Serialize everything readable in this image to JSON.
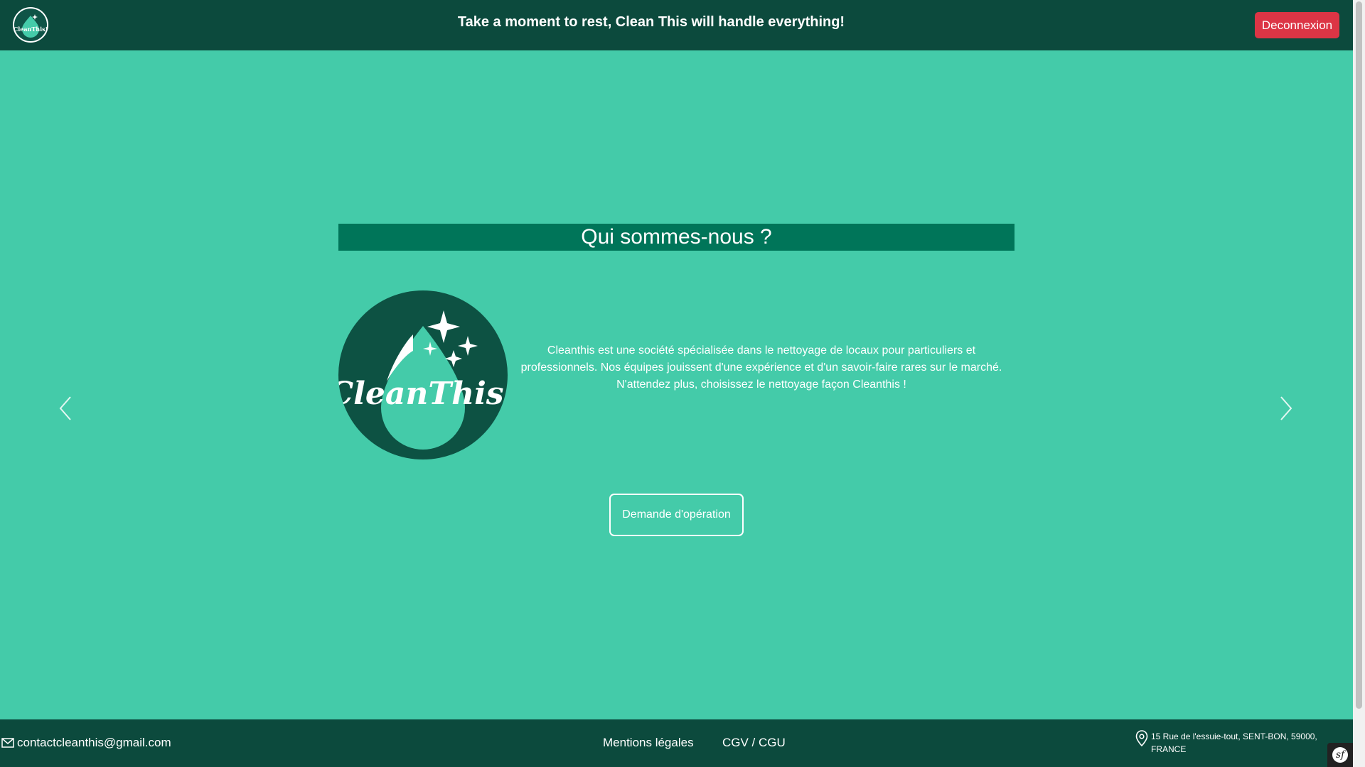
{
  "header": {
    "tagline": "Take a moment to rest, Clean This will handle everything!",
    "logout_label": "Deconnexion",
    "logo_text": "CleanThis!"
  },
  "main": {
    "title": "Qui sommes-nous ?",
    "logo_text": "CleanThis!",
    "description_lines": [
      "Cleanthis est une société spécialisée dans le nettoyage de locaux pour particuliers et",
      "professionnels. Nos équipes jouissent d'une expérience et d'un savoir-faire rares sur le marché.",
      "N'attendez plus, choisissez le nettoyage façon Cleanthis !"
    ],
    "button_label": "Demande d'opération",
    "prev_icon": "chevron-left-icon",
    "next_icon": "chevron-right-icon"
  },
  "footer": {
    "email": "contactcleanthis@gmail.com",
    "links": [
      "Mentions légales",
      "CGV / CGU"
    ],
    "address": "15 Rue de l'essuie-tout, SENT-BON, 59000, FRANCE",
    "email_icon": "mail-icon",
    "address_icon": "map-pin-icon"
  },
  "colors": {
    "background": "#44cba9",
    "header": "#0c4a3d",
    "title_bar": "#007559",
    "logout": "#dc3545"
  }
}
